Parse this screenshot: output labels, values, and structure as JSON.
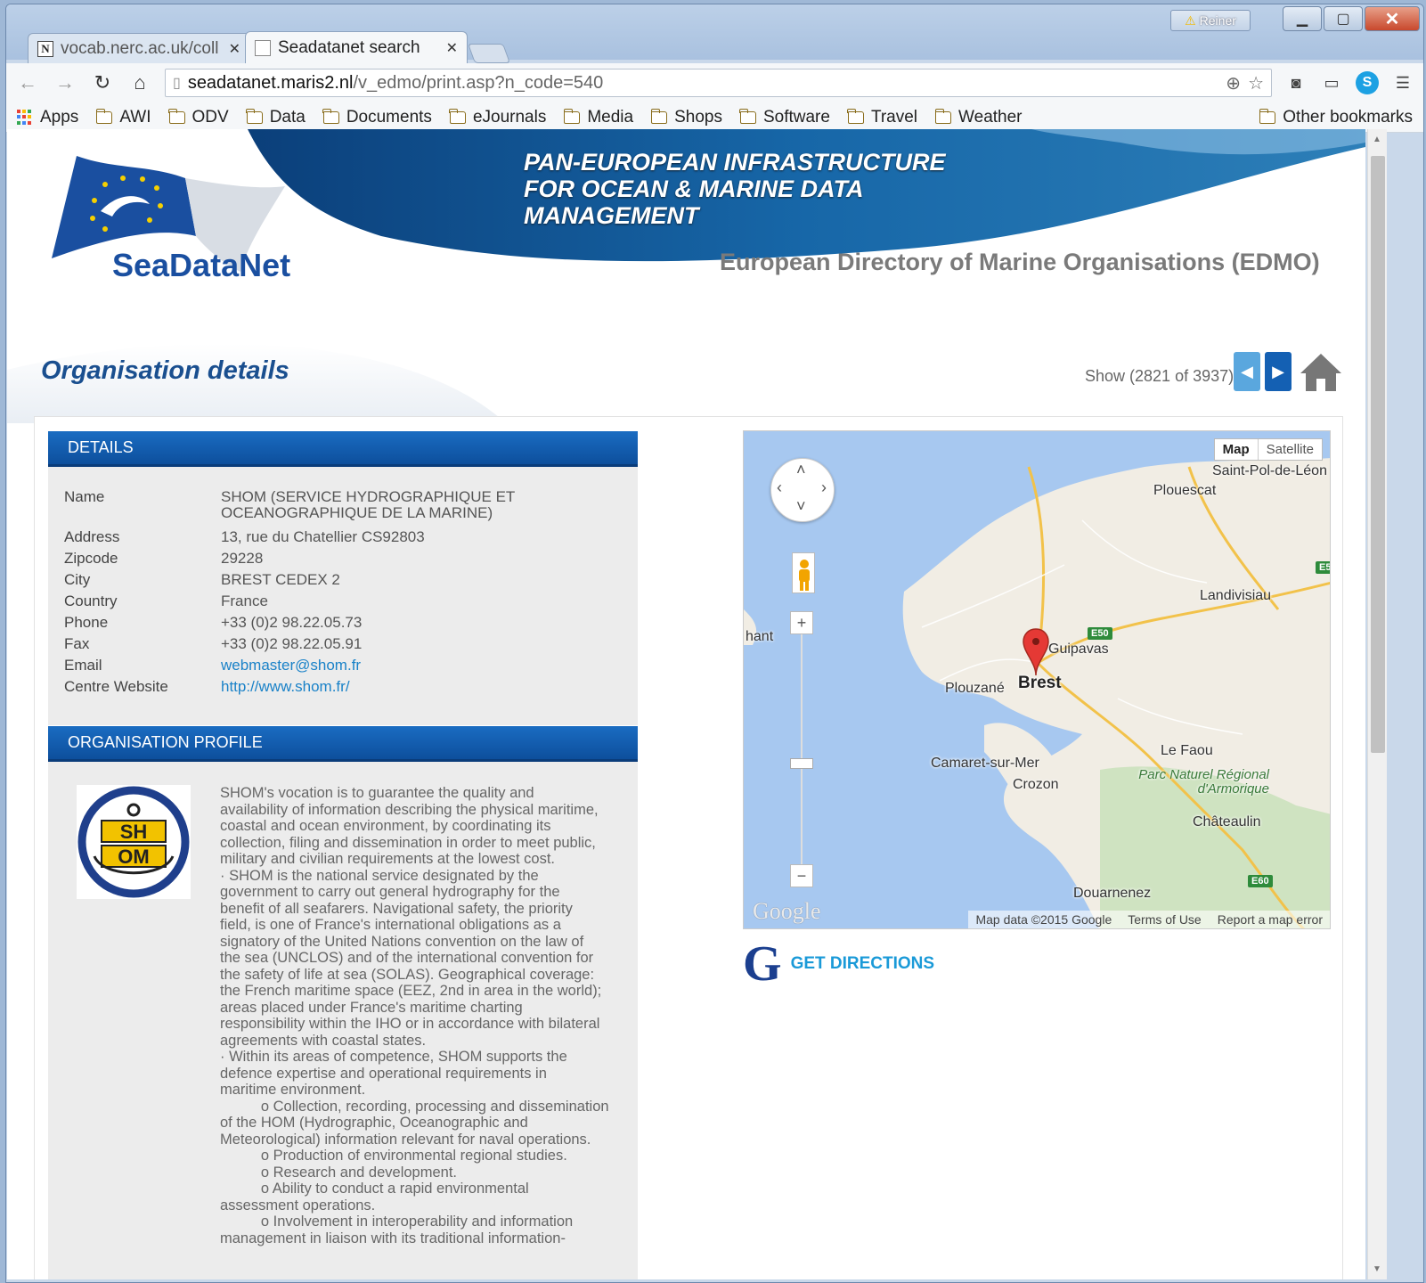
{
  "browser": {
    "user_badge": "Reiner",
    "tabs": [
      {
        "title": "vocab.nerc.ac.uk/coll",
        "favicon": "N",
        "active": false
      },
      {
        "title": "Seadatanet search",
        "active": true
      }
    ],
    "url_host": "seadatanet.maris2.nl",
    "url_path": "/v_edmo/print.asp?n_code=540",
    "bookmarks": [
      "Apps",
      "AWI",
      "ODV",
      "Data",
      "Documents",
      "eJournals",
      "Media",
      "Shops",
      "Software",
      "Travel",
      "Weather"
    ],
    "other_bookmarks": "Other bookmarks"
  },
  "banner": {
    "tagline_lines": [
      "PAN-EUROPEAN INFRASTRUCTURE",
      "FOR OCEAN & MARINE DATA",
      "MANAGEMENT"
    ],
    "logo_text": "SeaDataNet",
    "directory_title": "European Directory of Marine Organisations (EDMO)"
  },
  "page": {
    "title": "Organisation details",
    "show_count": "Show (2821 of 3937)"
  },
  "details": {
    "header": "DETAILS",
    "fields": [
      {
        "label": "Name",
        "value": "SHOM (SERVICE HYDROGRAPHIQUE ET OCEANOGRAPHIQUE DE LA MARINE)"
      },
      {
        "label": "Address",
        "value": "13, rue du Chatellier CS92803"
      },
      {
        "label": "Zipcode",
        "value": "29228"
      },
      {
        "label": "City",
        "value": "BREST CEDEX 2"
      },
      {
        "label": "Country",
        "value": "France"
      },
      {
        "label": "Phone",
        "value": "+33 (0)2 98.22.05.73"
      },
      {
        "label": "Fax",
        "value": "+33 (0)2 98.22.05.91"
      },
      {
        "label": "Email",
        "value": "webmaster@shom.fr"
      },
      {
        "label": "Centre Website",
        "value": "http://www.shom.fr/"
      }
    ]
  },
  "profile": {
    "header": "ORGANISATION PROFILE",
    "logo_text": "SHOM",
    "text": "SHOM's vocation is to guarantee the quality and\navailability of information describing the physical maritime,\ncoastal and ocean environment, by coordinating its\ncollection, filing and dissemination in order to meet public,\nmilitary and civilian requirements at the lowest cost.\n· SHOM is the national service designated by the\ngovernment to carry out general hydrography for the\nbenefit of all seafarers. Navigational safety, the priority\nfield, is one of France's international obligations as a\nsignatory of the United Nations convention on the law of\nthe sea (UNCLOS) and of the international convention for\nthe safety of life at sea (SOLAS). Geographical coverage:\nthe French maritime space (EEZ, 2nd in area in the world);\nareas placed under France's maritime charting\nresponsibility within the IHO or in accordance with bilateral\nagreements with coastal states.\n· Within its areas of competence, SHOM supports the\ndefence expertise and operational requirements in\nmaritime environment.\n          o Collection, recording, processing and dissemination\nof the HOM (Hydrographic, Oceanographic and\nMeteorological) information relevant for naval operations.\n          o Production of environmental regional studies.\n          o Research and development.\n          o Ability to conduct a rapid environmental\nassessment operations.\n          o Involvement in interoperability and information\nmanagement in liaison with its traditional information-"
  },
  "map": {
    "type_map": "Map",
    "type_satellite": "Satellite",
    "places": [
      "Saint-Pol-de-Léon",
      "Plouescat",
      "Landivisiau",
      "hant",
      "Guipavas",
      "Plouzané",
      "Brest",
      "Le Faou",
      "Camaret-sur-Mer",
      "Crozon",
      "Parc Naturel Régional d'Armorique",
      "Châteaulin",
      "Douarnenez"
    ],
    "roads": [
      "E50",
      "E60",
      "E5"
    ],
    "google": "Google",
    "footer": [
      "Map data ©2015 Google",
      "Terms of Use",
      "Report a map error"
    ]
  },
  "directions": {
    "label": "GET DIRECTIONS",
    "icon_letter": "G"
  },
  "colors": {
    "header_blue": "#0d4f9c",
    "link_blue": "#1a82c8",
    "title_blue": "#1a4f8f"
  }
}
